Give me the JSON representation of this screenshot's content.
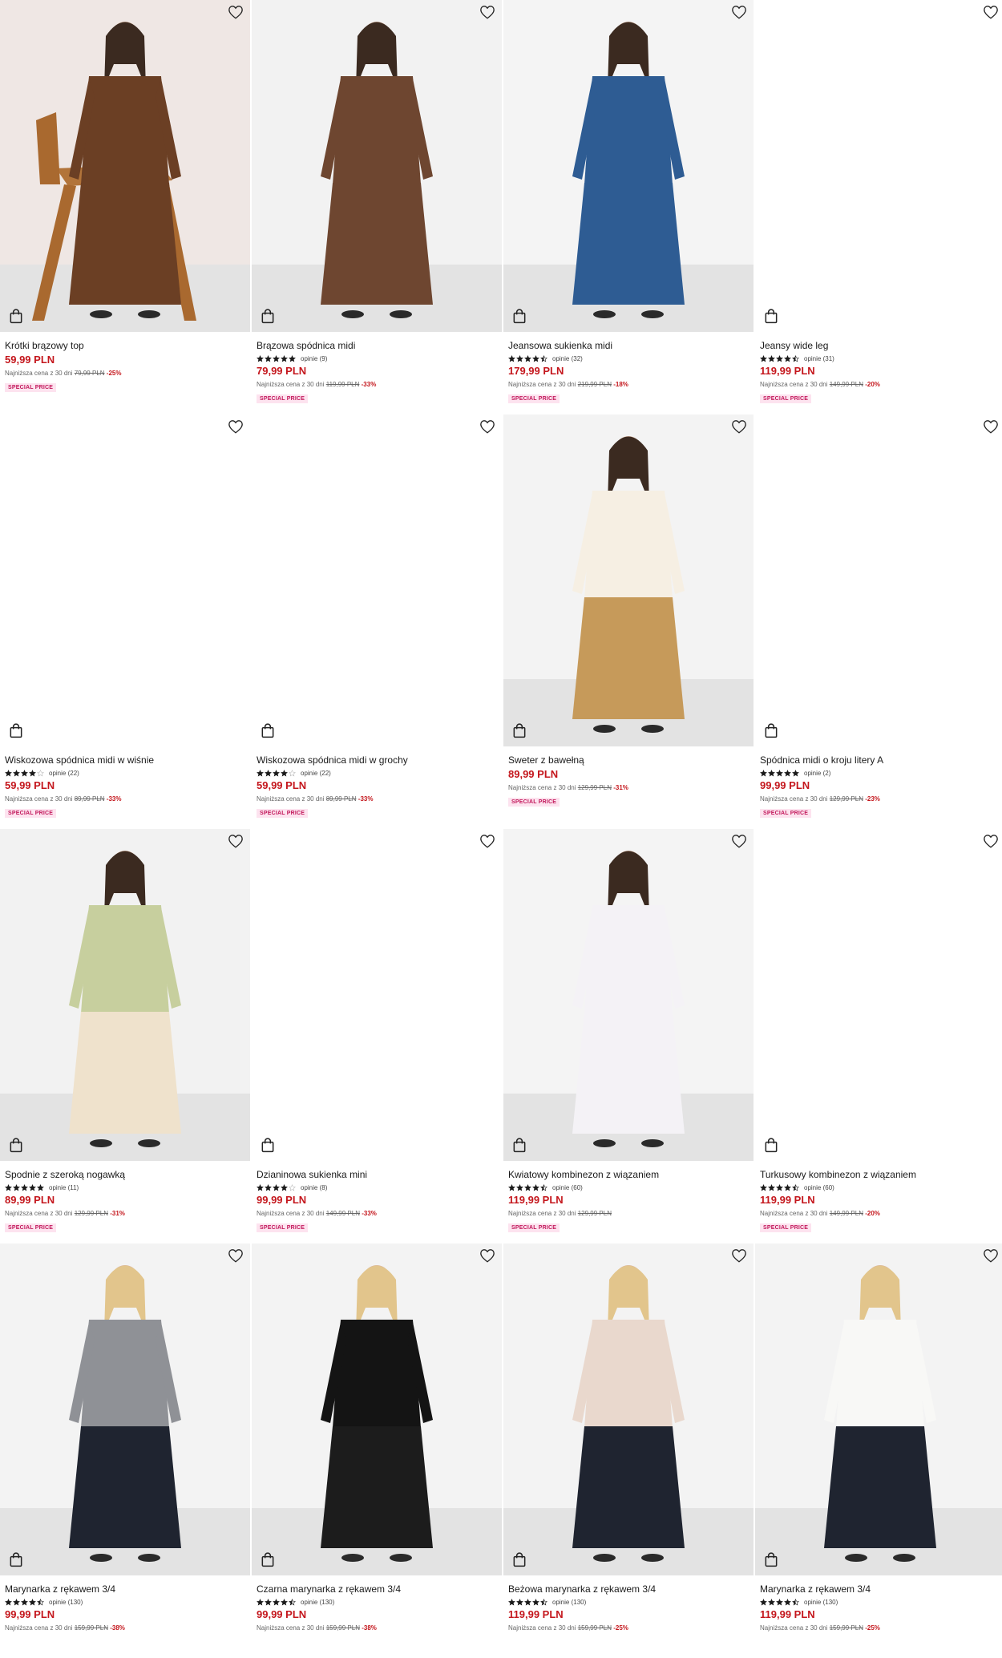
{
  "products": [
    {
      "name": "Krótki brązowy top",
      "rating": null,
      "reviews": "",
      "price": "59,99 PLN",
      "lowest_label": "Najniższa cena z 30 dni",
      "lowest_price": "79,99 PLN",
      "discount": "-25%",
      "badge": "SPECIAL PRICE"
    },
    {
      "name": "Brązowa spódnica midi",
      "rating": 5,
      "reviews": "opinie (9)",
      "price": "79,99 PLN",
      "lowest_label": "Najniższa cena z 30 dni",
      "lowest_price": "119,99 PLN",
      "discount": "-33%",
      "badge": "SPECIAL PRICE"
    },
    {
      "name": "Jeansowa sukienka midi",
      "rating": 4.5,
      "reviews": "opinie (32)",
      "price": "179,99 PLN",
      "lowest_label": "Najniższa cena z 30 dni",
      "lowest_price": "219,99 PLN",
      "discount": "-18%",
      "badge": "SPECIAL PRICE"
    },
    {
      "name": "Jeansy wide leg",
      "rating": 4.5,
      "reviews": "opinie (31)",
      "price": "119,99 PLN",
      "lowest_label": "Najniższa cena z 30 dni",
      "lowest_price": "149,99 PLN",
      "discount": "-20%",
      "badge": "SPECIAL PRICE"
    },
    {
      "name": "Wiskozowa spódnica midi w wiśnie",
      "rating": 4,
      "reviews": "opinie (22)",
      "price": "59,99 PLN",
      "lowest_label": "Najniższa cena z 30 dni",
      "lowest_price": "89,99 PLN",
      "discount": "-33%",
      "badge": "SPECIAL PRICE"
    },
    {
      "name": "Wiskozowa spódnica midi w grochy",
      "rating": 4,
      "reviews": "opinie (22)",
      "price": "59,99 PLN",
      "lowest_label": "Najniższa cena z 30 dni",
      "lowest_price": "89,99 PLN",
      "discount": "-33%",
      "badge": "SPECIAL PRICE"
    },
    {
      "name": "Sweter z bawełną",
      "rating": null,
      "reviews": "",
      "price": "89,99 PLN",
      "lowest_label": "Najniższa cena z 30 dni",
      "lowest_price": "129,99 PLN",
      "discount": "-31%",
      "badge": "SPECIAL PRICE"
    },
    {
      "name": "Spódnica midi o kroju litery A",
      "rating": 5,
      "reviews": "opinie (2)",
      "price": "99,99 PLN",
      "lowest_label": "Najniższa cena z 30 dni",
      "lowest_price": "129,99 PLN",
      "discount": "-23%",
      "badge": "SPECIAL PRICE"
    },
    {
      "name": "Spodnie z szeroką nogawką",
      "rating": 5,
      "reviews": "opinie (11)",
      "price": "89,99 PLN",
      "lowest_label": "Najniższa cena z 30 dni",
      "lowest_price": "129,99 PLN",
      "discount": "-31%",
      "badge": "SPECIAL PRICE"
    },
    {
      "name": "Dzianinowa sukienka mini",
      "rating": 4,
      "reviews": "opinie (8)",
      "price": "99,99 PLN",
      "lowest_label": "Najniższa cena z 30 dni",
      "lowest_price": "149,99 PLN",
      "discount": "-33%",
      "badge": "SPECIAL PRICE"
    },
    {
      "name": "Kwiatowy kombinezon z wiązaniem",
      "rating": 4.5,
      "reviews": "opinie (60)",
      "price": "119,99 PLN",
      "lowest_label": "Najniższa cena z 30 dni",
      "lowest_price": "129,99 PLN",
      "discount": "",
      "badge": "SPECIAL PRICE"
    },
    {
      "name": "Turkusowy kombinezon z wiązaniem",
      "rating": 4.5,
      "reviews": "opinie (60)",
      "price": "119,99 PLN",
      "lowest_label": "Najniższa cena z 30 dni",
      "lowest_price": "149,99 PLN",
      "discount": "-20%",
      "badge": "SPECIAL PRICE"
    },
    {
      "name": "Marynarka z rękawem 3/4",
      "rating": 4.5,
      "reviews": "opinie (130)",
      "price": "99,99 PLN",
      "lowest_label": "Najniższa cena z 30 dni",
      "lowest_price": "159,99 PLN",
      "discount": "-38%",
      "badge": ""
    },
    {
      "name": "Czarna marynarka z rękawem 3/4",
      "rating": 4.5,
      "reviews": "opinie (130)",
      "price": "99,99 PLN",
      "lowest_label": "Najniższa cena z 30 dni",
      "lowest_price": "159,99 PLN",
      "discount": "-38%",
      "badge": ""
    },
    {
      "name": "Beżowa marynarka z rękawem 3/4",
      "rating": 4.5,
      "reviews": "opinie (130)",
      "price": "119,99 PLN",
      "lowest_label": "Najniższa cena z 30 dni",
      "lowest_price": "159,99 PLN",
      "discount": "-25%",
      "badge": ""
    },
    {
      "name": "Marynarka z rękawem 3/4",
      "rating": 4.5,
      "reviews": "opinie (130)",
      "price": "119,99 PLN",
      "lowest_label": "Najniższa cena z 30 dni",
      "lowest_price": "159,99 PLN",
      "discount": "-25%",
      "badge": ""
    }
  ],
  "images": [
    {
      "kind": "photo",
      "bg": "#efe7e4",
      "garment": "#6b3f24",
      "garment2": "#6b3f24",
      "prop": "chair"
    },
    {
      "kind": "photo",
      "bg": "#f2f2f2",
      "garment": "#6e4630",
      "garment2": "#6e4630",
      "prop": "none"
    },
    {
      "kind": "photo",
      "bg": "#f4f4f4",
      "garment": "#2e5c93",
      "garment2": "#2e5c93",
      "prop": "none"
    },
    {
      "kind": "blank"
    },
    {
      "kind": "blank"
    },
    {
      "kind": "blank"
    },
    {
      "kind": "photo",
      "bg": "#f3f3f3",
      "garment": "#f6efe3",
      "garment2": "#c69a5a",
      "prop": "none"
    },
    {
      "kind": "blank"
    },
    {
      "kind": "photo",
      "bg": "#f2f2f2",
      "garment": "#c7cf9e",
      "garment2": "#efe2cc",
      "prop": "none"
    },
    {
      "kind": "blank"
    },
    {
      "kind": "photo",
      "bg": "#f4f4f4",
      "garment": "#f4f2f6",
      "garment2": "#f4f2f6",
      "prop": "none"
    },
    {
      "kind": "blank"
    },
    {
      "kind": "photo",
      "bg": "#f3f3f3",
      "garment": "#8f9196",
      "garment2": "#1f2430",
      "prop": "none"
    },
    {
      "kind": "photo",
      "bg": "#f3f3f3",
      "garment": "#141414",
      "garment2": "#1c1c1c",
      "prop": "none"
    },
    {
      "kind": "photo",
      "bg": "#f3f3f3",
      "garment": "#e9d8cd",
      "garment2": "#1f2430",
      "prop": "none"
    },
    {
      "kind": "photo",
      "bg": "#f3f3f3",
      "garment": "#f8f8f6",
      "garment2": "#1f2430",
      "prop": "none"
    }
  ],
  "colors": {
    "price": "#c4161c",
    "badge_bg": "#fde3ef",
    "badge_text": "#c2185b",
    "star": "#1a1a1a"
  },
  "icons": {
    "wishlist": "heart-icon",
    "cart": "shopping-bag-icon",
    "rating": "star-icon"
  }
}
